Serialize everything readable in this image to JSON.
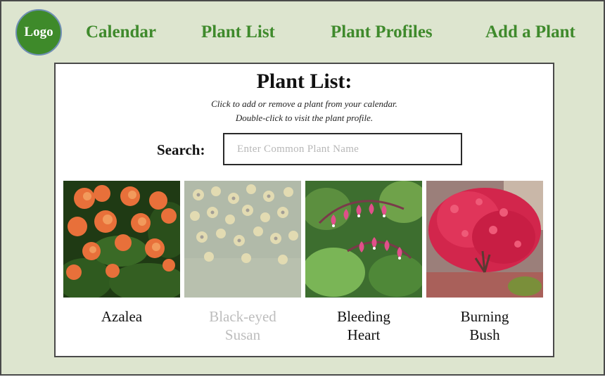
{
  "nav": {
    "logo_label": "Logo",
    "links": [
      "Calendar",
      "Plant List",
      "Plant Profiles",
      "Add a Plant"
    ]
  },
  "panel": {
    "title": "Plant List:",
    "instruction_1": "Click to add or remove a plant from your calendar.",
    "instruction_2": "Double-click to visit the plant profile."
  },
  "search": {
    "label": "Search:",
    "placeholder": "Enter Common Plant Name",
    "value": ""
  },
  "plants": [
    {
      "name": "Azalea",
      "in_calendar": true
    },
    {
      "name": "Black-eyed\nSusan",
      "in_calendar": false
    },
    {
      "name": "Bleeding\nHeart",
      "in_calendar": true
    },
    {
      "name": "Burning\nBush",
      "in_calendar": true
    }
  ],
  "colors": {
    "background": "#dde5cf",
    "nav_text": "#3f8a2c",
    "logo_fill": "#3e8a2a",
    "inactive_text": "#bdbdbd"
  }
}
